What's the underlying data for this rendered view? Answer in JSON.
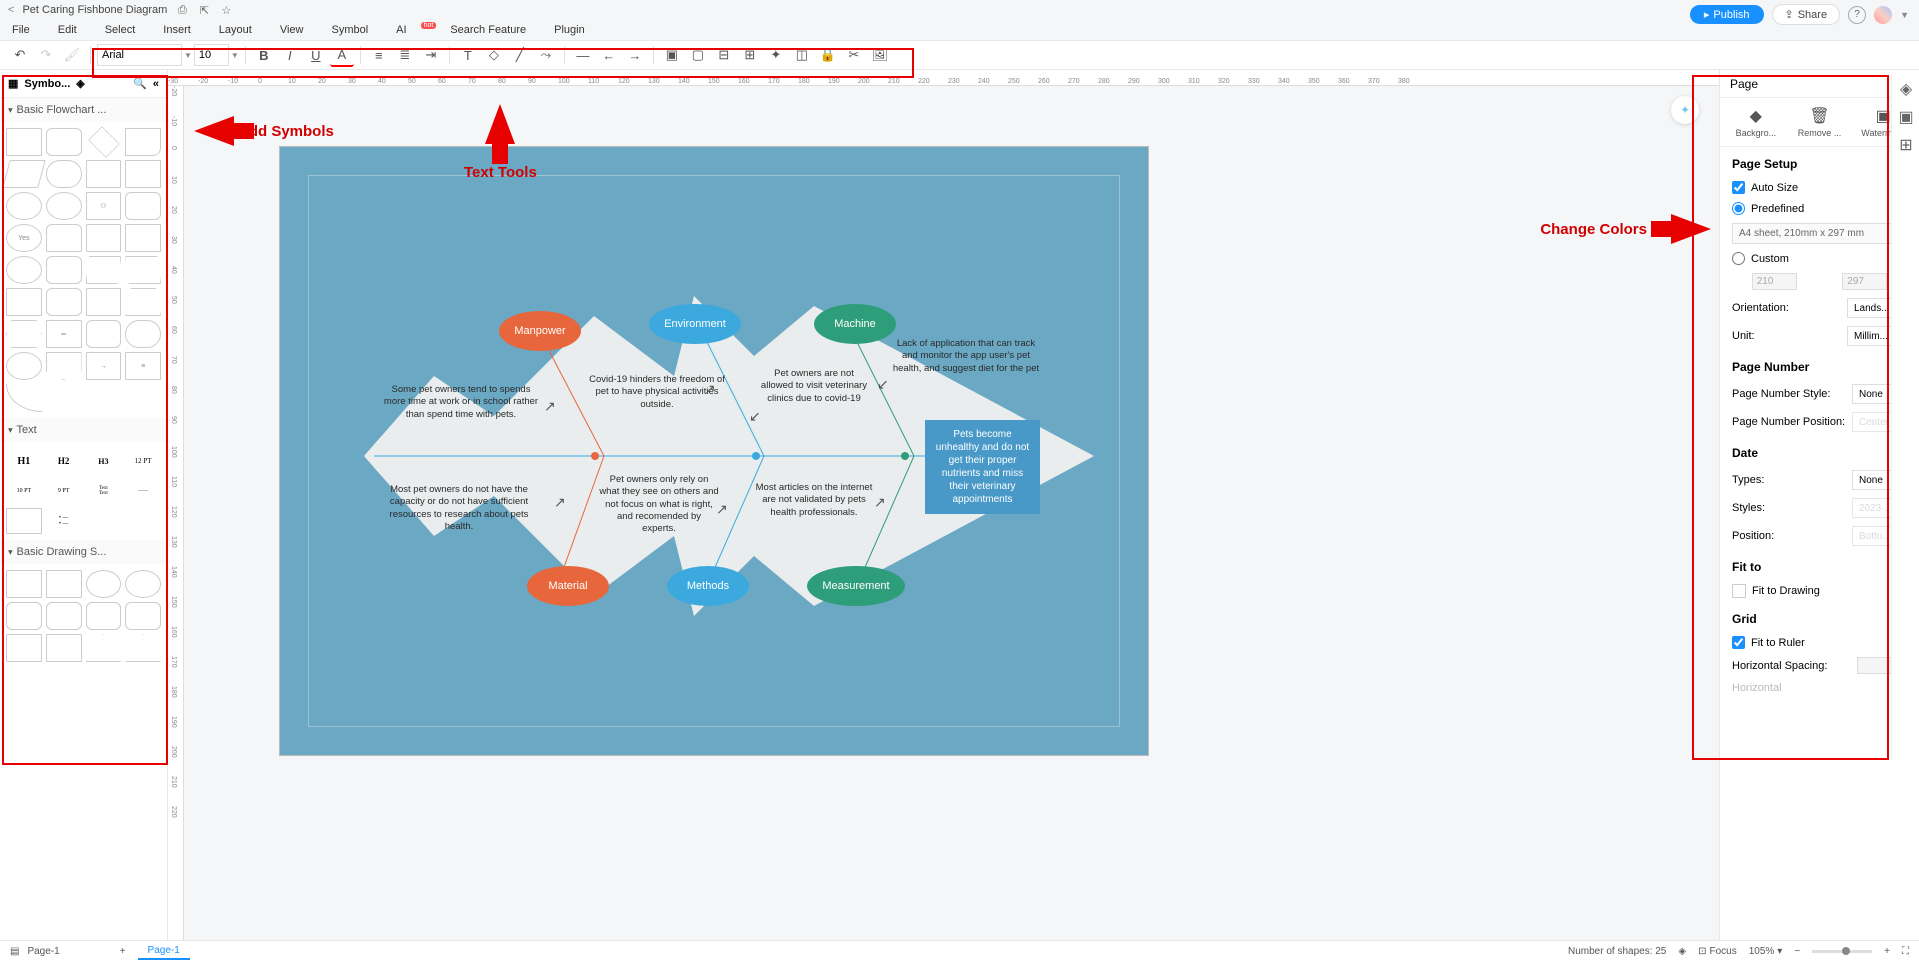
{
  "titlebar": {
    "doc_title": "Pet Caring Fishbone Diagram",
    "publish": "Publish",
    "share": "Share"
  },
  "menu": {
    "file": "File",
    "edit": "Edit",
    "select": "Select",
    "insert": "Insert",
    "layout": "Layout",
    "view": "View",
    "symbol": "Symbol",
    "ai": "AI",
    "search_feature": "Search Feature",
    "plugin": "Plugin",
    "hot": "hot"
  },
  "toolbar": {
    "font": "Arial",
    "size": "10"
  },
  "left": {
    "title": "Symbo...",
    "sec1": "Basic Flowchart ...",
    "sec2": "Text",
    "sec3": "Basic Drawing S...",
    "h1": "H1",
    "h2": "H2",
    "h3": "H3",
    "pt12": "12 PT",
    "pt10": "10 PT",
    "pt9": "9 PT",
    "yes": "Yes"
  },
  "annotations": {
    "add_symbols": "Add Symbols",
    "text_tools": "Text Tools",
    "change_colors": "Change Colors"
  },
  "fishbone": {
    "causes_top": {
      "manpower": "Manpower",
      "environment": "Environment",
      "machine": "Machine"
    },
    "causes_bottom": {
      "material": "Material",
      "methods": "Methods",
      "measurement": "Measurement"
    },
    "texts": {
      "manpower1": "Some pet owners tend to spends more time at work or in school rather than spend time with pets.",
      "manpower2": "Most pet owners do not have the capacity or do not have sufficient resources to research about pets health.",
      "environment1": "Covid-19 hinders the freedom of pet to have physical activities outside.",
      "environment2": "Pet owners only rely on what they see on others and not focus on what is right, and recomended by experts.",
      "machine1": "Pet owners are not allowed to visit veterinary clinics due to covid-19",
      "machine2": "Lack of application that can track and monitor the app user's pet health, and suggest diet for the pet",
      "measurement1": "Most articles on the internet are not validated by pets health professionals."
    },
    "effect": "Pets become unhealthy and do not get their proper nutrients and miss their veterinary appointments"
  },
  "right": {
    "title": "Page",
    "background": "Backgro...",
    "remove": "Remove ...",
    "watermark": "Waterma...",
    "page_setup": "Page Setup",
    "auto_size": "Auto Size",
    "predefined": "Predefined",
    "custom": "Custom",
    "preset": "A4 sheet, 210mm x 297 mm",
    "w": "210",
    "h": "297",
    "orientation": "Orientation:",
    "orientation_val": "Lands...",
    "unit": "Unit:",
    "unit_val": "Millim...",
    "page_number": "Page Number",
    "pn_style": "Page Number Style:",
    "pn_style_val": "None",
    "pn_pos": "Page Number Position:",
    "pn_pos_val": "Center",
    "date": "Date",
    "types": "Types:",
    "types_val": "None",
    "styles": "Styles:",
    "styles_val": "2023-...",
    "position": "Position:",
    "position_val": "Botto...",
    "fit_to": "Fit to",
    "fit_drawing": "Fit to Drawing",
    "grid": "Grid",
    "fit_ruler": "Fit to Ruler",
    "h_spacing": "Horizontal Spacing:",
    "horizontal": "Horizontal"
  },
  "statusbar": {
    "page_label": "Page-1",
    "tab": "Page-1",
    "shapes": "Number of shapes: 25",
    "focus": "Focus",
    "zoom": "105%"
  },
  "ruler_h": [
    "-30",
    "-20",
    "-10",
    "0",
    "10",
    "20",
    "30",
    "40",
    "50",
    "60",
    "70",
    "80",
    "90",
    "100",
    "110",
    "120",
    "130",
    "140",
    "150",
    "160",
    "170",
    "180",
    "190",
    "200",
    "210",
    "220",
    "230",
    "240",
    "250",
    "260",
    "270",
    "280",
    "290",
    "300",
    "310",
    "320",
    "330",
    "340",
    "350",
    "360",
    "370",
    "380"
  ],
  "ruler_v": [
    "-20",
    "-10",
    "0",
    "10",
    "20",
    "30",
    "40",
    "50",
    "60",
    "70",
    "80",
    "90",
    "100",
    "110",
    "120",
    "130",
    "140",
    "150",
    "160",
    "170",
    "180",
    "190",
    "200",
    "210",
    "220"
  ]
}
